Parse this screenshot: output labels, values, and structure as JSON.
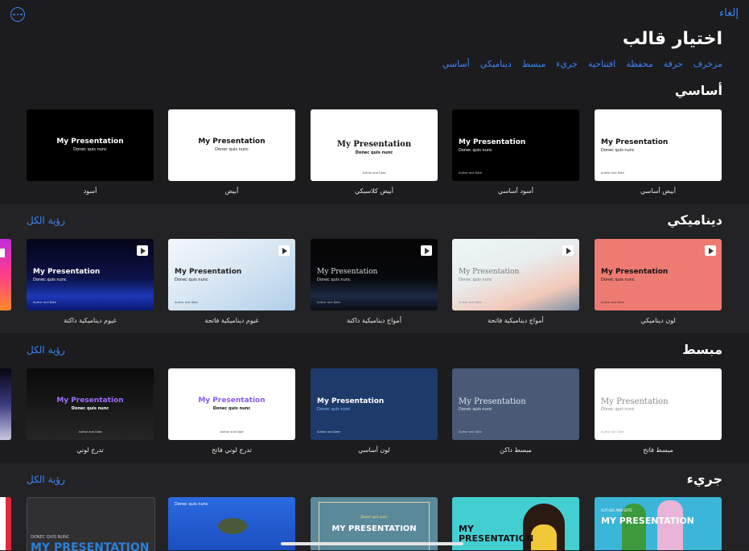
{
  "header": {
    "cancel_label": "إلغاء",
    "title": "اختيار قالب",
    "more_icon": "ellipsis-circle-icon"
  },
  "categories": [
    "أساسي",
    "ديناميكي",
    "مبسط",
    "جريء",
    "افتتاحية",
    "محفظة",
    "حرفة",
    "مزخرف"
  ],
  "see_all_label": "رؤية الكل",
  "sections": [
    {
      "title": "أساسي",
      "themes": [
        {
          "label": "أبيض أساسي",
          "title": "My Presentation",
          "subtitle": "Donec quis nunc",
          "footer": "Author and Date"
        },
        {
          "label": "أسود أساسي",
          "title": "My Presentation",
          "subtitle": "Donec quis nunc",
          "footer": "Author and Date"
        },
        {
          "label": "أبيض كلاسيكي",
          "title": "My Presentation",
          "subtitle": "Donec quis nunc",
          "footer": "Author and Date"
        },
        {
          "label": "أبيض",
          "title": "My Presentation",
          "subtitle": "Donec quis nunc"
        },
        {
          "label": "أسود",
          "title": "My Presentation",
          "subtitle": "Donec quis nunc"
        }
      ]
    },
    {
      "title": "ديناميكي",
      "themes": [
        {
          "label": "لون ديناميكي",
          "title": "My Presentation",
          "subtitle": "Donec quis nunc",
          "footer": "Author and Date"
        },
        {
          "label": "أمواج ديناميكية فاتحة",
          "title": "My Presentation",
          "subtitle": "Donec quis nunc",
          "footer": "Author and Date"
        },
        {
          "label": "أمواج ديناميكية داكنة",
          "title": "My Presentation",
          "subtitle": "Donec quis nunc",
          "footer": "Author and Date"
        },
        {
          "label": "غيوم ديناميكية فاتحة",
          "title": "My Presentation",
          "subtitle": "Donec quis nunc",
          "footer": "Author and Date"
        },
        {
          "label": "غيوم ديناميكية داكنة",
          "title": "My Presentation",
          "subtitle": "Donec quis nunc",
          "footer": "Author and Date"
        }
      ]
    },
    {
      "title": "مبسط",
      "themes": [
        {
          "label": "مبسط فاتح",
          "title": "My Presentation",
          "subtitle": "Donec quis nunc",
          "footer": "Author and Date"
        },
        {
          "label": "مبسط داكن",
          "title": "My Presentation",
          "subtitle": "Donec quis nunc",
          "footer": "Author and Date"
        },
        {
          "label": "لون أساسي",
          "title": "My Presentation",
          "subtitle": "Donec quis nunc",
          "footer": "Author and Date"
        },
        {
          "label": "تدرج لوني فاتح",
          "title": "My Presentation",
          "subtitle": "Donec quis nunc",
          "footer": "Author and Date"
        },
        {
          "label": "تدرج لوني",
          "title": "My Presentation",
          "subtitle": "Donec quis nunc",
          "footer": "Author and Date"
        }
      ]
    },
    {
      "title": "جريء",
      "themes": [
        {
          "title": "MY PRESENTATION",
          "subtitle": "AUTHOR AND DATE"
        },
        {
          "title": "MY PRESENTATION"
        },
        {
          "title": "MY PRESENTATION",
          "subtitle": "Donec quis nunc"
        },
        {
          "title": "Donec quis nunc"
        },
        {
          "title": "MY PRESENTATION",
          "subtitle": "DONEC QUIS NUNC"
        }
      ]
    }
  ],
  "colors": {
    "accent": "#3b82f6",
    "background": "#1c1c1e",
    "dynamic_color_bg": "#ee7b72",
    "primary_color_bg": "#1d3a6b",
    "simple_dark_bg": "#4a5a76"
  }
}
